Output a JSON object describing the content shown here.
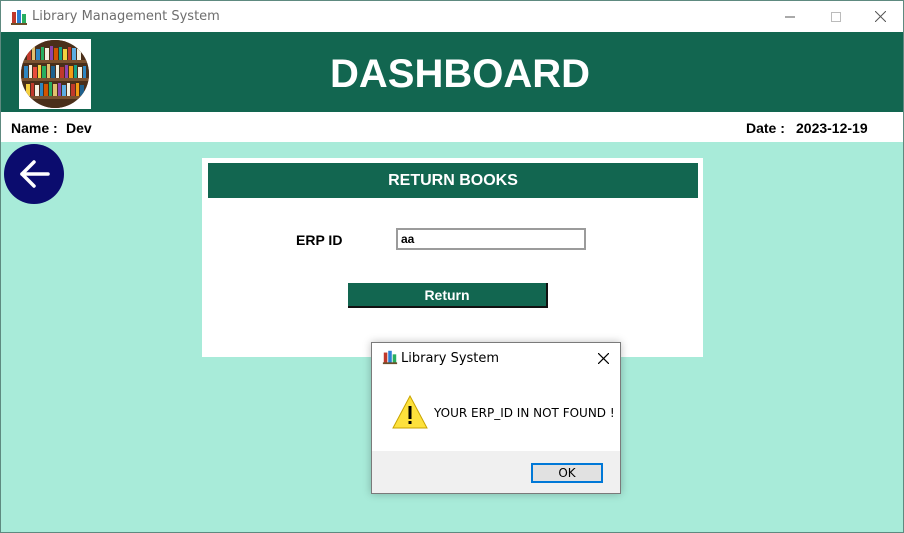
{
  "window": {
    "title": "Library Management System",
    "icon": "books-icon"
  },
  "header": {
    "title": "DASHBOARD",
    "logo": "bookshelf-image"
  },
  "info": {
    "name_label": "Name :",
    "name_value": "Dev",
    "date_label": "Date :",
    "date_value": "2023-12-19"
  },
  "back_button": {
    "icon": "arrow-left-icon"
  },
  "return_form": {
    "title": "RETURN BOOKS",
    "erp_label": "ERP ID",
    "erp_value": "aa",
    "return_label": "Return"
  },
  "dialog": {
    "title": "Library System",
    "message": "YOUR ERP_ID IN NOT FOUND !",
    "ok_label": "OK",
    "icon": "warning-icon"
  },
  "colors": {
    "primary_green": "#126650",
    "background_mint": "#a8ebd9",
    "back_button_navy": "#0b0c6e",
    "ok_focus_blue": "#0078d7"
  }
}
